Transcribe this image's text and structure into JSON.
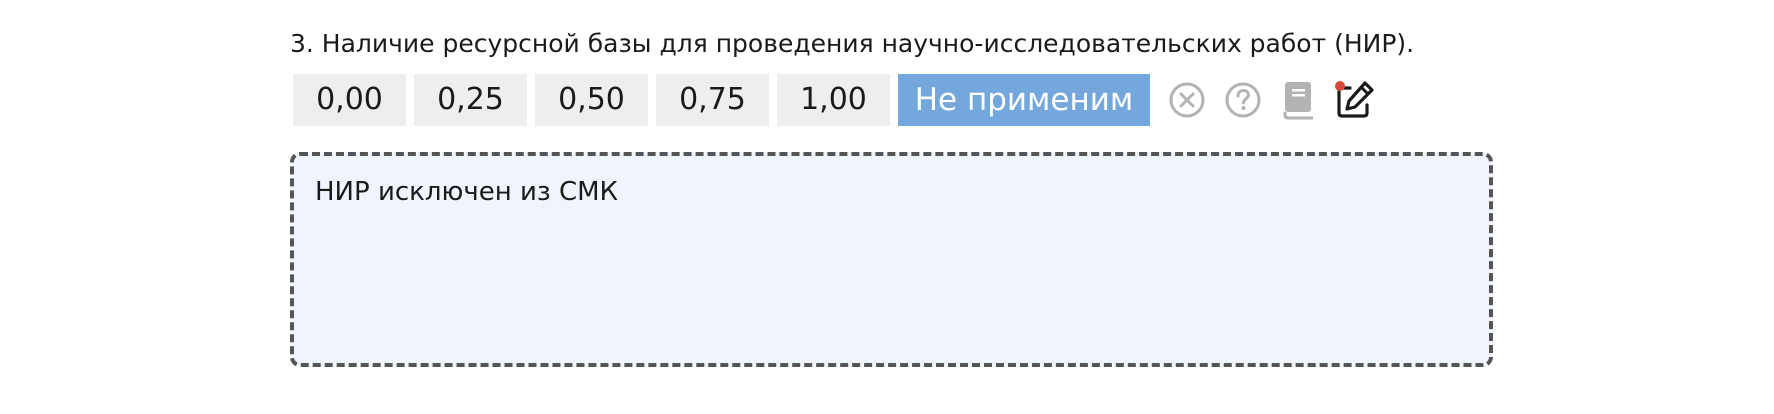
{
  "question": {
    "title": "3. Наличие ресурсной базы для проведения научно-исследовательских работ (НИР).",
    "score_options": [
      "0,00",
      "0,25",
      "0,50",
      "0,75",
      "1,00"
    ],
    "not_applicable_label": "Не применим",
    "selected": "Не применим",
    "icons": {
      "clear": "close-circle-icon",
      "help": "question-circle-icon",
      "docs": "book-icon",
      "edit": "edit-icon"
    },
    "comment": "НИР исключен из СМК"
  },
  "colors": {
    "selected_bg": "#74a7dc",
    "option_bg": "#eeeeee",
    "comment_bg": "#f0f5fd",
    "comment_border": "#555555",
    "icon_gray": "#b3b3b3",
    "notification_dot": "#d9463b"
  }
}
